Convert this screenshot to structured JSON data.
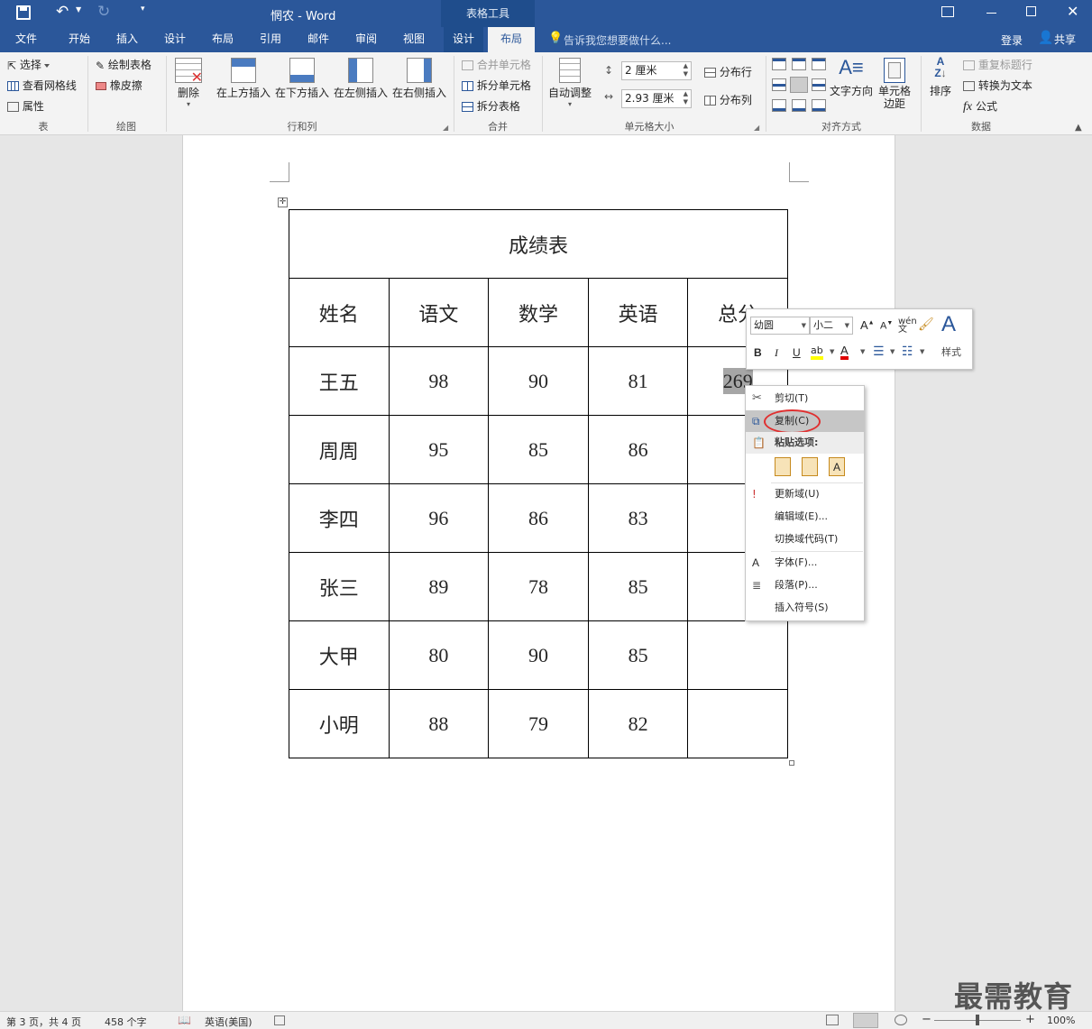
{
  "title": {
    "doc": "惘农",
    "app": "Word",
    "separator": " - ",
    "context_tab": "表格工具"
  },
  "tabs": [
    {
      "label": "文件"
    },
    {
      "label": "开始"
    },
    {
      "label": "插入"
    },
    {
      "label": "设计"
    },
    {
      "label": "布局"
    },
    {
      "label": "引用"
    },
    {
      "label": "邮件"
    },
    {
      "label": "审阅"
    },
    {
      "label": "视图"
    },
    {
      "label": "设计"
    },
    {
      "label": "布局"
    }
  ],
  "tellme": "告诉我您想要做什么...",
  "login": "登录",
  "share": "共享",
  "ribbon": {
    "table": {
      "select": "选择",
      "gridlines": "查看网格线",
      "properties": "属性",
      "label": "表"
    },
    "draw": {
      "draw_table": "绘制表格",
      "eraser": "橡皮擦",
      "label": "绘图"
    },
    "rowcol": {
      "delete": "删除",
      "insert_above": "在上方插入",
      "insert_below": "在下方插入",
      "insert_left": "在左侧插入",
      "insert_right": "在右侧插入",
      "label": "行和列"
    },
    "merge": {
      "merge_cells": "合并单元格",
      "split_cells": "拆分单元格",
      "split_table": "拆分表格",
      "label": "合并"
    },
    "cellsize": {
      "autofit": "自动调整",
      "height": "2 厘米",
      "width": "2.93 厘米",
      "dist_rows": "分布行",
      "dist_cols": "分布列",
      "label": "单元格大小"
    },
    "align": {
      "text_dir": "文字方向",
      "margins": "单元格\n边距",
      "margins_l1": "单元格",
      "margins_l2": "边距",
      "label": "对齐方式"
    },
    "data": {
      "sort": "排序",
      "repeat_header": "重复标题行",
      "to_text": "转换为文本",
      "formula": "公式",
      "label": "数据"
    }
  },
  "table": {
    "title": "成绩表",
    "headers": [
      "姓名",
      "语文",
      "数学",
      "英语",
      "总分"
    ],
    "rows": [
      {
        "name": "王五",
        "chinese": "98",
        "math": "90",
        "english": "81",
        "total": "269"
      },
      {
        "name": "周周",
        "chinese": "95",
        "math": "85",
        "english": "86",
        "total": ""
      },
      {
        "name": "李四",
        "chinese": "96",
        "math": "86",
        "english": "83",
        "total": ""
      },
      {
        "name": "张三",
        "chinese": "89",
        "math": "78",
        "english": "85",
        "total": ""
      },
      {
        "name": "大甲",
        "chinese": "80",
        "math": "90",
        "english": "85",
        "total": ""
      },
      {
        "name": "小明",
        "chinese": "88",
        "math": "79",
        "english": "82",
        "total": ""
      }
    ]
  },
  "minitoolbar": {
    "font": "幼圆",
    "size": "小二",
    "styles": "样式"
  },
  "context_menu": {
    "cut": "剪切(T)",
    "copy": "复制(C)",
    "paste_options": "粘贴选项:",
    "update_field": "更新域(U)",
    "edit_field": "编辑域(E)...",
    "toggle_codes": "切换域代码(T)",
    "font": "字体(F)...",
    "paragraph": "段落(P)...",
    "insert_symbol": "插入符号(S)"
  },
  "status": {
    "page": "第 3 页，共 4 页",
    "words": "458 个字",
    "lang": "英语(美国)",
    "zoom": "100%"
  },
  "watermark": "最需教育",
  "colors": {
    "accent": "#2b579a",
    "highlight": "#c6c6c6",
    "circle": "#e03030"
  }
}
